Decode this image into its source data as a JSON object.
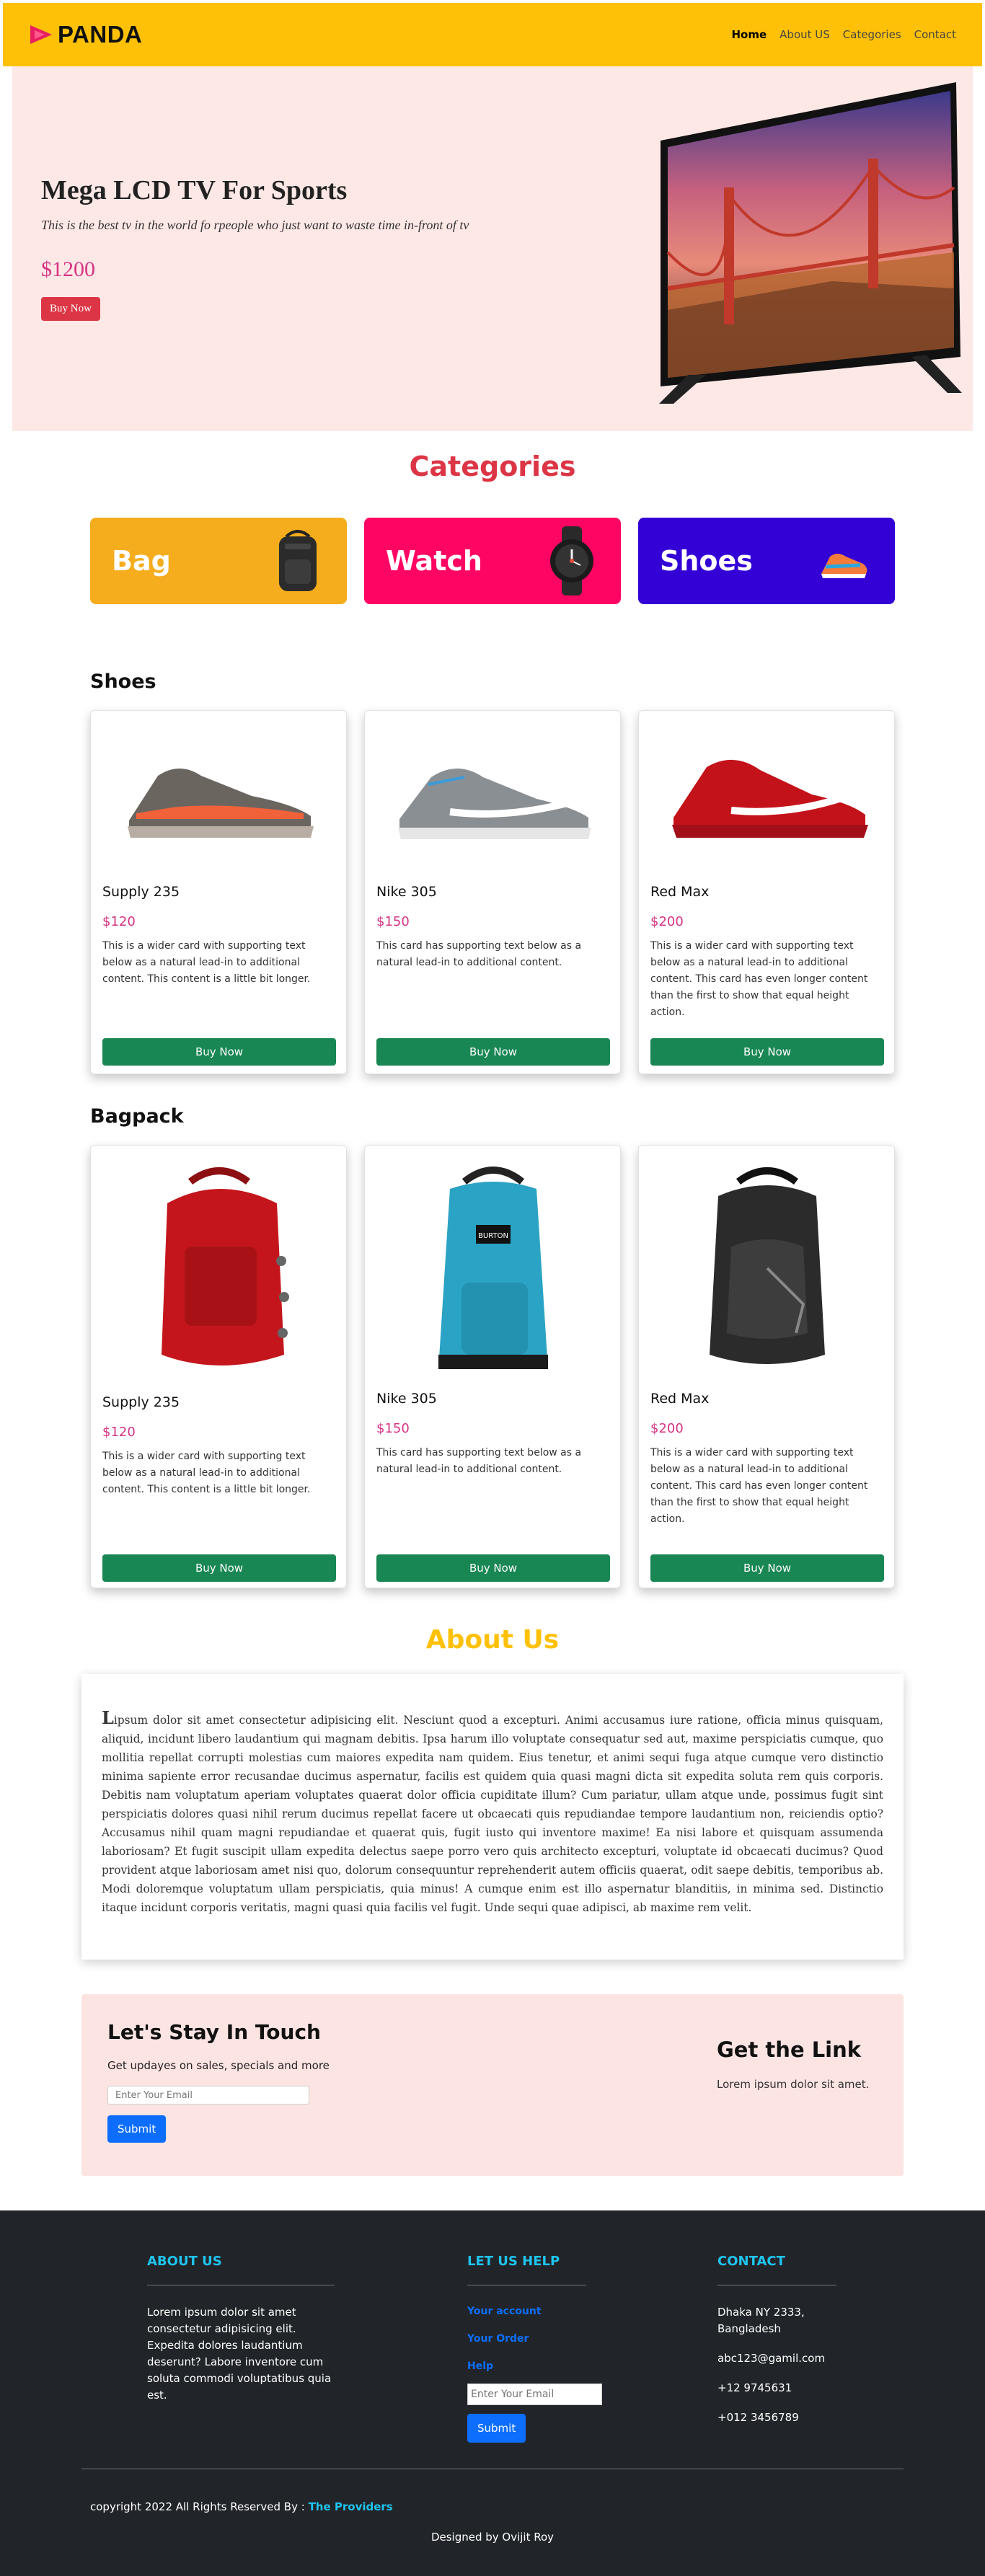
{
  "navbar": {
    "brand": "PANDA",
    "links": [
      "Home",
      "About US",
      "Categories",
      "Contact"
    ],
    "brand_color": "#ffc107"
  },
  "hero": {
    "title": "Mega LCD TV For Sports",
    "subtitle": "This is the best tv in the world fo rpeople who just want to waste time in-front of tv",
    "price": "$1200",
    "button": "Buy Now"
  },
  "categories": {
    "title": "Categories",
    "items": [
      {
        "label": "Bag",
        "color": "#f5ad1d",
        "icon": "backpack-icon"
      },
      {
        "label": "Watch",
        "color": "#ff0563",
        "icon": "watch-icon"
      },
      {
        "label": "Shoes",
        "color": "#3300d6",
        "icon": "sneaker-icon"
      }
    ]
  },
  "shoes": {
    "title": "Shoes",
    "items": [
      {
        "name": "Supply 235",
        "price": "$120",
        "text": "This is a wider card with supporting text below as a natural lead-in to additional content. This content is a little bit longer.",
        "button": "Buy Now"
      },
      {
        "name": "Nike 305",
        "price": "$150",
        "text": "This card has supporting text below as a natural lead-in to additional content.",
        "button": "Buy Now"
      },
      {
        "name": "Red Max",
        "price": "$200",
        "text": "This is a wider card with supporting text below as a natural lead-in to additional content. This card has even longer content than the first to show that equal height action.",
        "button": "Buy Now"
      }
    ]
  },
  "bagpack": {
    "title": "Bagpack",
    "items": [
      {
        "name": "Supply 235",
        "price": "$120",
        "text": "This is a wider card with supporting text below as a natural lead-in to additional content. This content is a little bit longer.",
        "button": "Buy Now"
      },
      {
        "name": "Nike 305",
        "price": "$150",
        "text": "This card has supporting text below as a natural lead-in to additional content.",
        "button": "Buy Now",
        "bag_tag": "BURTON"
      },
      {
        "name": "Red Max",
        "price": "$200",
        "text": "This is a wider card with supporting text below as a natural lead-in to additional content. This card has even longer content than the first to show that equal height action.",
        "button": "Buy Now"
      }
    ]
  },
  "about": {
    "title": "About Us",
    "text": "Lipsum dolor sit amet consectetur adipisicing elit. Nesciunt quod a excepturi. Animi accusamus iure ratione, officia minus quisquam, aliquid, incidunt libero laudantium qui magnam debitis. Ipsa harum illo voluptate consequatur sed aut, maxime perspiciatis cumque, quo mollitia repellat corrupti molestias cum maiores expedita nam quidem. Eius tenetur, et animi sequi fuga atque cumque vero distinctio minima sapiente error recusandae ducimus aspernatur, facilis est quidem quia quasi magni dicta sit expedita soluta rem quis corporis. Debitis nam voluptatum aperiam voluptates quaerat dolor officia cupiditate illum? Cum pariatur, ullam atque unde, possimus fugit sint perspiciatis dolores quasi nihil rerum ducimus repellat facere ut obcaecati quis repudiandae tempore laudantium non, reiciendis optio? Accusamus nihil quam magni repudiandae et quaerat quis, fugit iusto qui inventore maxime! Ea nisi labore et quisquam assumenda laboriosam? Et fugit suscipit ullam expedita delectus saepe porro vero quis architecto excepturi, voluptate id obcaecati ducimus? Quod provident atque laboriosam amet nisi quo, dolorum consequuntur reprehenderit autem officiis quaerat, odit saepe debitis, temporibus ab. Modi doloremque voluptatum ullam perspiciatis, quia minus! A cumque enim est illo aspernatur blanditiis, in minima sed. Distinctio itaque incidunt corporis veritatis, magni quasi quia facilis vel fugit. Unde sequi quae adipisci, ab maxime rem velit."
  },
  "touch": {
    "title": "Let's Stay In Touch",
    "subtitle": "Get updayes on sales, specials and more",
    "placeholder": "Enter Your Email",
    "button": "Submit",
    "link_title": "Get the Link",
    "link_text": "Lorem ipsum dolor sit amet."
  },
  "footer": {
    "about_head": "ABOUT US",
    "about_text": "Lorem ipsum dolor sit amet consectetur adipisicing elit. Expedita dolores laudantium deserunt? Labore inventore cum soluta commodi voluptatibus quia est.",
    "help_head": "LET US HELP",
    "help_links": [
      "Your account",
      "Your Order",
      "Help"
    ],
    "help_placeholder": "Enter Your Email",
    "help_button": "Submit",
    "contact_head": "CONTACT",
    "address": "Dhaka NY 2333, Bangladesh",
    "email": "abc123@gamil.com",
    "phone1": "+12 9745631",
    "phone2": "+012 3456789",
    "copyright": "copyright 2022 All Rights Reserved By :",
    "providers": "The Providers",
    "designed": "Designed by Ovijit Roy"
  }
}
